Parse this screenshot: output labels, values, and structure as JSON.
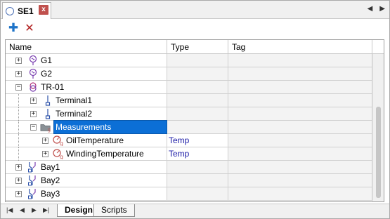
{
  "document_tab": {
    "label": "SE1",
    "close_label": "x"
  },
  "tab_nav": {
    "prev": "◀",
    "next": "▶"
  },
  "toolbar": {
    "add_label": "✚",
    "delete_label": "✕"
  },
  "columns": {
    "name": "Name",
    "type": "Type",
    "tag": "Tag"
  },
  "rows": [
    {
      "id": "g1",
      "name": "G1",
      "type": "",
      "tag": "",
      "expander": "+",
      "icon": "generator-icon"
    },
    {
      "id": "g2",
      "name": "G2",
      "type": "",
      "tag": "",
      "expander": "+",
      "icon": "generator-icon"
    },
    {
      "id": "tr01",
      "name": "TR-01",
      "type": "",
      "tag": "",
      "expander": "−",
      "icon": "transformer-icon"
    },
    {
      "id": "terminal1",
      "name": "Terminal1",
      "type": "",
      "tag": "",
      "expander": "+",
      "icon": "terminal-icon"
    },
    {
      "id": "terminal2",
      "name": "Terminal2",
      "type": "",
      "tag": "",
      "expander": "+",
      "icon": "terminal-icon"
    },
    {
      "id": "measurements",
      "name": "Measurements",
      "type": "",
      "tag": "",
      "expander": "−",
      "icon": "folder-icon",
      "selected": true
    },
    {
      "id": "oiltemp",
      "name": "OilTemperature",
      "type": "Temp",
      "tag": "",
      "expander": "+",
      "icon": "measurement-icon"
    },
    {
      "id": "windtemp",
      "name": "WindingTemperature",
      "type": "Temp",
      "tag": "",
      "expander": "+",
      "icon": "measurement-icon"
    },
    {
      "id": "bay1",
      "name": "Bay1",
      "type": "",
      "tag": "",
      "expander": "+",
      "icon": "bay-icon"
    },
    {
      "id": "bay2",
      "name": "Bay2",
      "type": "",
      "tag": "",
      "expander": "+",
      "icon": "bay-icon"
    },
    {
      "id": "bay3",
      "name": "Bay3",
      "type": "",
      "tag": "",
      "expander": "+",
      "icon": "bay-icon"
    }
  ],
  "bottom_tabs": [
    {
      "label": "Design",
      "active": true
    },
    {
      "label": "Scripts",
      "active": false
    }
  ],
  "bottom_nav": {
    "first": "|◀",
    "prev": "◀",
    "next": "▶",
    "last": "▶|"
  },
  "colors": {
    "selection": "#0c6fd6",
    "type_text": "#1a1aa6",
    "add_icon": "#1e73c8",
    "delete_icon": "#b22222"
  }
}
